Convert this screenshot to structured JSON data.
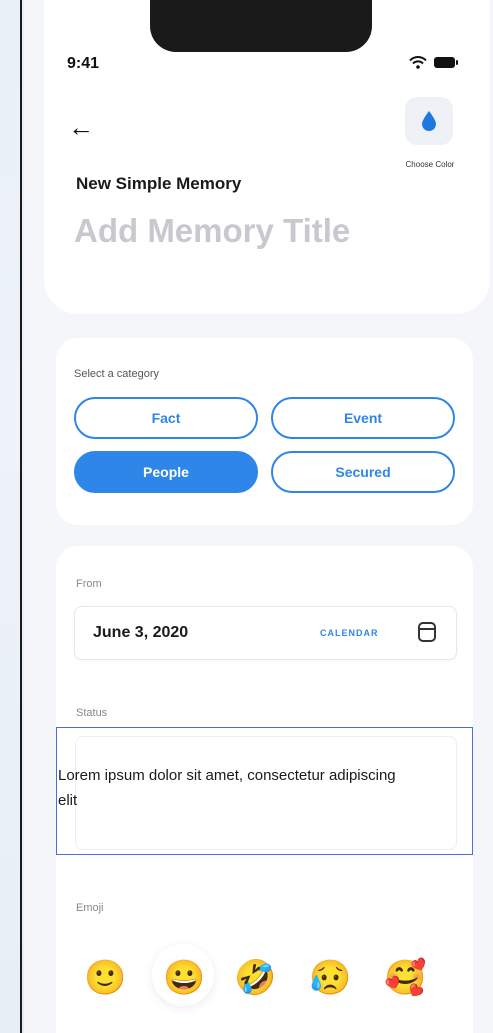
{
  "status_bar": {
    "time": "9:41"
  },
  "header": {
    "choose_color_label": "Choose Color",
    "memory_type": "New Simple Memory",
    "title_placeholder": "Add Memory Title"
  },
  "category": {
    "label": "Select a category",
    "options": [
      "Fact",
      "Event",
      "People",
      "Secured"
    ],
    "selected": "People"
  },
  "form": {
    "from_label": "From",
    "date_value": "June 3, 2020",
    "calendar_link": "CALENDAR",
    "status_label": "Status",
    "status_text": "Lorem ipsum dolor sit amet, consectetur adipiscing elit",
    "emoji_label": "Emoji",
    "emojis": [
      "🙂",
      "😀",
      "🤣",
      "😥",
      "🥰"
    ],
    "selected_emoji_index": 1
  },
  "colors": {
    "accent": "#2e86e8",
    "drop": "#1e78e0"
  }
}
